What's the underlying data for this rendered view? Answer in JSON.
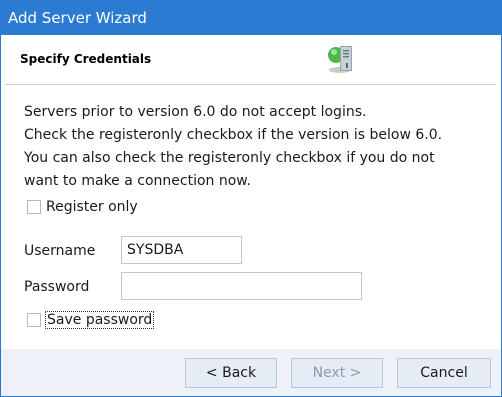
{
  "window": {
    "title": "Add Server Wizard"
  },
  "header": {
    "title": "Specify Credentials",
    "icon": "server-icon"
  },
  "description": {
    "lines": [
      "Servers prior to version 6.0 do not accept logins.",
      "Check the registeronly checkbox if the version is below 6.0.",
      "You can also check the registeronly checkbox if you do not",
      "want to make a connection now."
    ]
  },
  "register_only": {
    "label": "Register only",
    "checked": false
  },
  "username": {
    "label": "Username",
    "value": "SYSDBA"
  },
  "password": {
    "label": "Password",
    "value": ""
  },
  "save_password": {
    "label": "Save password",
    "checked": false
  },
  "buttons": {
    "back": "< Back",
    "next": "Next >",
    "cancel": "Cancel"
  },
  "colors": {
    "titlebar": "#2b7bd3",
    "footer": "#eef2f8",
    "button": "#e6ecf5"
  }
}
